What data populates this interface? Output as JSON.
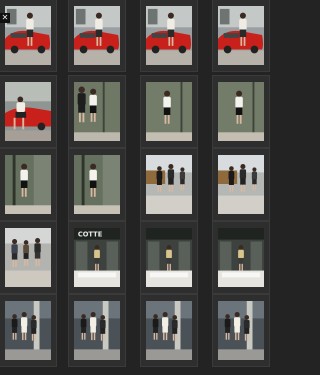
{
  "toolbar": {
    "close_icon": "close-icon",
    "close_glyph": "✕"
  },
  "grid": {
    "columns": 4,
    "rows": 5,
    "photos": [
      {
        "scene": "red-car-woman-standing"
      },
      {
        "scene": "red-car-woman-standing"
      },
      {
        "scene": "red-car-woman-standing"
      },
      {
        "scene": "red-car-woman-standing"
      },
      {
        "scene": "red-car-woman-crouching"
      },
      {
        "scene": "window-couple"
      },
      {
        "scene": "window-woman"
      },
      {
        "scene": "window-woman"
      },
      {
        "scene": "doorway-woman"
      },
      {
        "scene": "doorway-woman"
      },
      {
        "scene": "street-crowd"
      },
      {
        "scene": "street-crowd"
      },
      {
        "scene": "street-people"
      },
      {
        "scene": "storefront-woman",
        "sign": "COTTE"
      },
      {
        "scene": "storefront-woman"
      },
      {
        "scene": "storefront-woman"
      },
      {
        "scene": "street-group"
      },
      {
        "scene": "street-group"
      },
      {
        "scene": "street-group"
      },
      {
        "scene": "street-group"
      }
    ]
  },
  "colors": {
    "background": "#232323",
    "cell": "#2e2e2e",
    "car": "#c8201a",
    "dark_coat": "#1a1a1a",
    "window_green": "#5f6b52"
  }
}
